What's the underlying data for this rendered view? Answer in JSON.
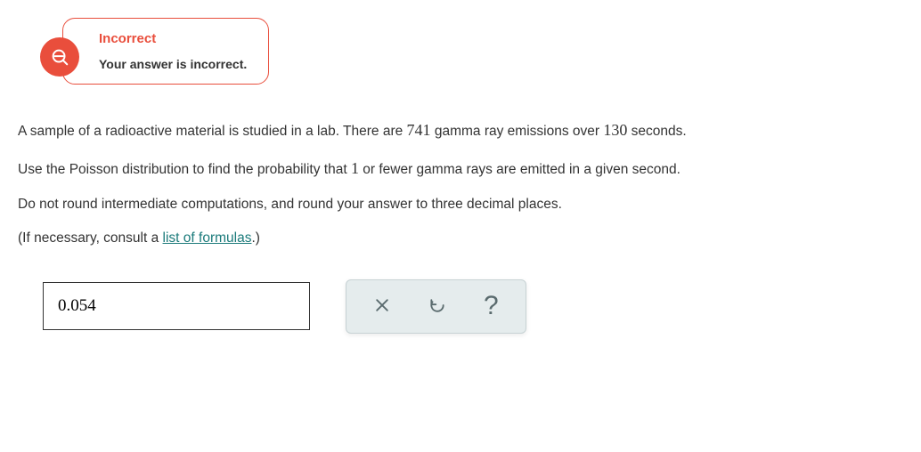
{
  "feedback": {
    "title": "Incorrect",
    "message": "Your answer is incorrect."
  },
  "question": {
    "part1": "A sample of a radioactive material is studied in a lab. There are ",
    "emissions": "741",
    "part2": " gamma ray emissions over ",
    "seconds": "130",
    "part3": " seconds.",
    "part4": "Use the Poisson distribution to find the probability that ",
    "threshold": "1",
    "part5": " or fewer gamma rays are emitted in a given second.",
    "part6": "Do not round intermediate computations, and round your answer to three decimal places.",
    "part7a": "(If necessary, consult a ",
    "link_text": "list of formulas",
    "part7b": ".)"
  },
  "answer": {
    "value": "0.054"
  }
}
